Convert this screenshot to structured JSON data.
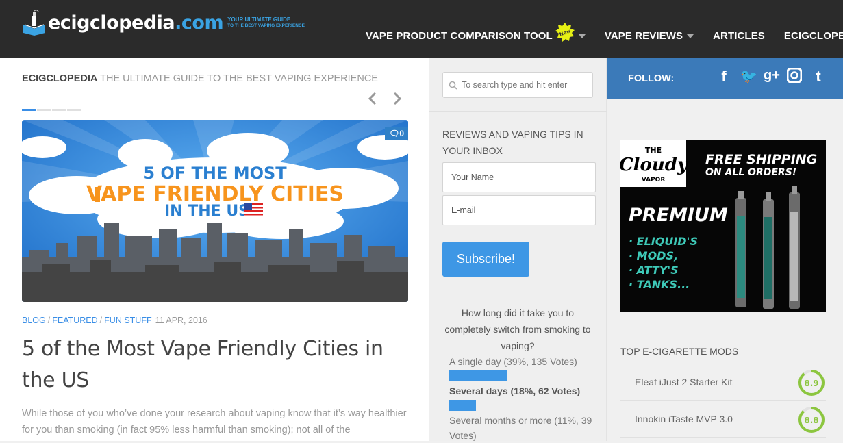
{
  "header": {
    "logo_text": "ecigclopedia",
    "logo_dot": ".com",
    "logo_tag_line1": "YOUR ULTIMATE GUIDE",
    "logo_tag_line2": "TO THE BEST VAPING EXPERIENCE",
    "nav": [
      {
        "label": "VAPE PRODUCT COMPARISON TOOL",
        "badge": "New",
        "has_caret": true
      },
      {
        "label": "VAPE REVIEWS",
        "has_caret": true
      },
      {
        "label": "ARTICLES",
        "has_caret": false
      },
      {
        "label": "ECIGCLOPEDIA",
        "has_caret": true
      }
    ]
  },
  "main": {
    "tagline_brand": "ECIGCLOPEDIA",
    "tagline_rest": " THE ULTIMATE GUIDE TO THE BEST VAPING EXPERIENCE",
    "hero": {
      "line1": "5 OF THE MOST",
      "line2": "VAPE FRIENDLY CITIES",
      "line3": "IN THE US",
      "comments": "0"
    },
    "meta": {
      "categories": [
        "BLOG",
        "FEATURED",
        "FUN STUFF"
      ],
      "date": "11 APR, 2016"
    },
    "title": "5 of the Most Vape Friendly Cities in the US",
    "excerpt": "While those of you who’ve done your research about vaping know that it’s way healthier for you than smoking (in fact 95% less harmful than smoking); not all of the"
  },
  "sidebar": {
    "search_placeholder": "To search type and hit enter",
    "newsletter_title": "REVIEWS AND VAPING TIPS IN YOUR INBOX",
    "name_placeholder": "Your Name",
    "email_placeholder": "E-mail",
    "subscribe_label": "Subscribe!",
    "poll": {
      "question": "How long did it take you to completely switch from smoking to vaping?",
      "options": [
        {
          "label": "A single day (39%, 135 Votes)",
          "pct": 39,
          "bold": false
        },
        {
          "label": "Several days (18%, 62 Votes)",
          "pct": 18,
          "bold": true
        },
        {
          "label": "Several months or more (11%, 39 Votes)",
          "pct": 11,
          "bold": false
        }
      ]
    }
  },
  "right": {
    "follow_label": "FOLLOW:",
    "social_icons": [
      "facebook-icon",
      "twitter-icon",
      "google-plus-icon",
      "instagram-icon",
      "tumblr-icon"
    ],
    "ad": {
      "brand_the": "THE",
      "brand_cloudy": "Cloudy",
      "brand_vapor": "VAPOR",
      "shipping_line1": "FREE SHIPPING",
      "shipping_line2": "ON ALL ORDERS!",
      "premium": "PREMIUM",
      "items": [
        "· ELIQUID'S",
        "· MODS,",
        "· ATTY'S",
        "· TANKS..."
      ]
    },
    "mods_title": "TOP E-CIGARETTE MODS",
    "mods": [
      {
        "name": "Eleaf iJust 2 Starter Kit",
        "score": "8.9",
        "pct": 0.89
      },
      {
        "name": "Innokin iTaste MVP 3.0",
        "score": "8.8",
        "pct": 0.88
      }
    ]
  },
  "colors": {
    "header_bg": "#2b2b2b",
    "accent_blue": "#3e97e5",
    "follow_bg": "#3b7ab9",
    "score_green": "#8cc63f",
    "hero_orange": "#f7941d",
    "ad_teal": "#3ec9b8",
    "badge_yellow": "#e6f014"
  }
}
